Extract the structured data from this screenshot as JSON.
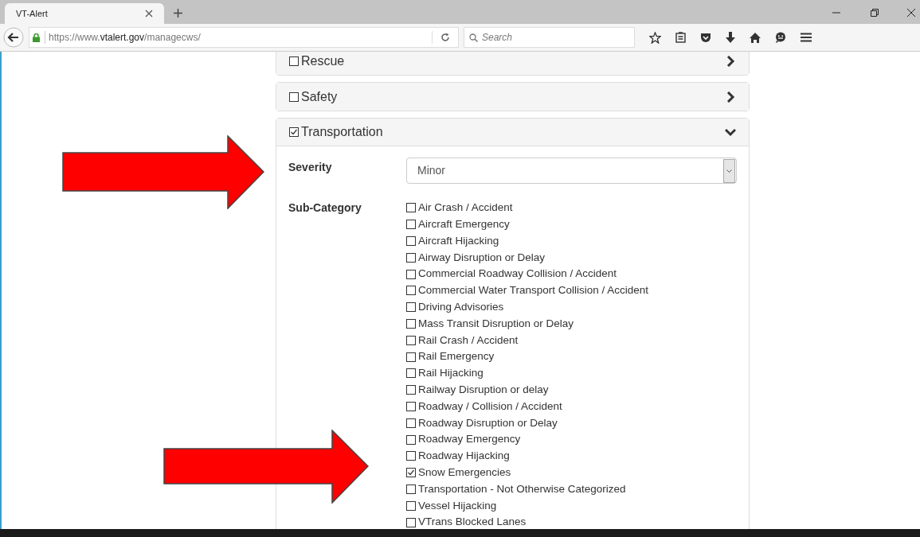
{
  "browser": {
    "tab_title": "VT-Alert",
    "url_host": "https://www.",
    "url_domain": "vtalert.gov",
    "url_path": "/managecws/",
    "search_placeholder": "Search"
  },
  "categories": [
    {
      "label": "Rescue",
      "checked": false,
      "expanded": false
    },
    {
      "label": "Safety",
      "checked": false,
      "expanded": false
    },
    {
      "label": "Transportation",
      "checked": true,
      "expanded": true,
      "severity_label": "Severity",
      "severity_value": "Minor",
      "subcategory_label": "Sub-Category",
      "subcategories": [
        {
          "label": "Air Crash / Accident",
          "checked": false
        },
        {
          "label": "Aircraft Emergency",
          "checked": false
        },
        {
          "label": "Aircraft Hijacking",
          "checked": false
        },
        {
          "label": "Airway Disruption or Delay",
          "checked": false
        },
        {
          "label": "Commercial Roadway Collision / Accident",
          "checked": false
        },
        {
          "label": "Commercial Water Transport Collision / Accident",
          "checked": false
        },
        {
          "label": "Driving Advisories",
          "checked": false
        },
        {
          "label": "Mass Transit Disruption or Delay",
          "checked": false
        },
        {
          "label": "Rail Crash / Accident",
          "checked": false
        },
        {
          "label": "Rail Emergency",
          "checked": false
        },
        {
          "label": "Rail Hijacking",
          "checked": false
        },
        {
          "label": "Railway Disruption or delay",
          "checked": false
        },
        {
          "label": "Roadway / Collision / Accident",
          "checked": false
        },
        {
          "label": "Roadway Disruption or Delay",
          "checked": false
        },
        {
          "label": "Roadway Emergency",
          "checked": false
        },
        {
          "label": "Roadway Hijacking",
          "checked": false
        },
        {
          "label": "Snow Emergencies",
          "checked": true
        },
        {
          "label": "Transportation - Not Otherwise Categorized",
          "checked": false
        },
        {
          "label": "Vessel Hijacking",
          "checked": false
        },
        {
          "label": "VTrans Blocked Lanes",
          "checked": false
        }
      ]
    }
  ]
}
